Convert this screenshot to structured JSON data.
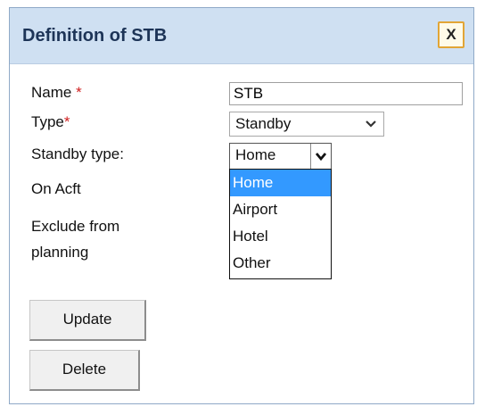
{
  "dialog": {
    "title": "Definition of STB",
    "close_label": "X"
  },
  "form": {
    "name_label": "Name",
    "type_label": "Type",
    "required_marker": "*",
    "standby_type_label": "Standby type:",
    "on_acft_label": "On Acft",
    "exclude_label_line1": "Exclude from",
    "exclude_label_line2": "planning",
    "name_value": "STB",
    "type_value": "Standby",
    "standby_type_value": "Home",
    "standby_options": [
      "Home",
      "Airport",
      "Hotel",
      "Other"
    ]
  },
  "buttons": {
    "update": "Update",
    "delete": "Delete"
  },
  "colors": {
    "title_bar": "#cfe0f2",
    "selected_option": "#3399ff",
    "required": "#d02020"
  }
}
